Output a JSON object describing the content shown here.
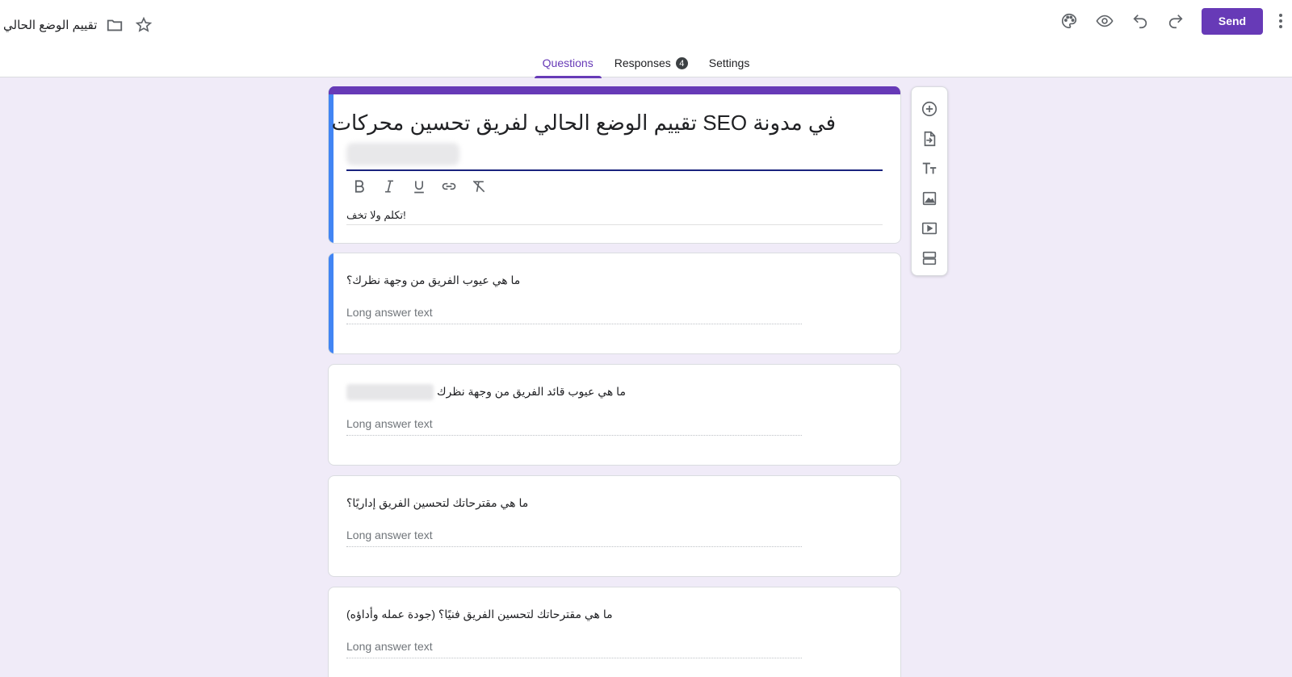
{
  "header": {
    "doc_title": "تقييم الوضع الحالي",
    "send_label": "Send",
    "icons": [
      "folder-icon",
      "star-icon",
      "palette-icon",
      "preview-icon",
      "undo-icon",
      "redo-icon",
      "more-vert-icon"
    ]
  },
  "tabs": [
    {
      "label": "Questions",
      "active": true
    },
    {
      "label": "Responses",
      "count": "4"
    },
    {
      "label": "Settings"
    }
  ],
  "form": {
    "title": "في مدونة SEO تقييم الوضع الحالي لفريق تحسين محركات البحث",
    "description": "!تكلم ولا تخف",
    "format_tools": [
      "bold-icon",
      "italic-icon",
      "underline-icon",
      "link-icon",
      "clear-format-icon"
    ]
  },
  "questions": [
    {
      "text": "ما هي عيوب الفريق من وجهة نظرك؟",
      "answer_placeholder": "Long answer text"
    },
    {
      "text": "ما هي عيوب قائد الفريق من وجهة نظرك",
      "answer_placeholder": "Long answer text"
    },
    {
      "text": "ما هي مقترحاتك لتحسين الفريق إداريًا؟",
      "answer_placeholder": "Long answer text"
    },
    {
      "text": "ما هي مقترحاتك لتحسين الفريق فنيًا؟ (جودة عمله وأداؤه)",
      "answer_placeholder": "Long answer text"
    }
  ],
  "side_toolbar": [
    "add-question-icon",
    "import-questions-icon",
    "add-title-icon",
    "add-image-icon",
    "add-video-icon",
    "add-section-icon"
  ],
  "colors": {
    "accent": "#673ab7",
    "selected_border": "#4285f4",
    "background": "#f0ebf8"
  }
}
